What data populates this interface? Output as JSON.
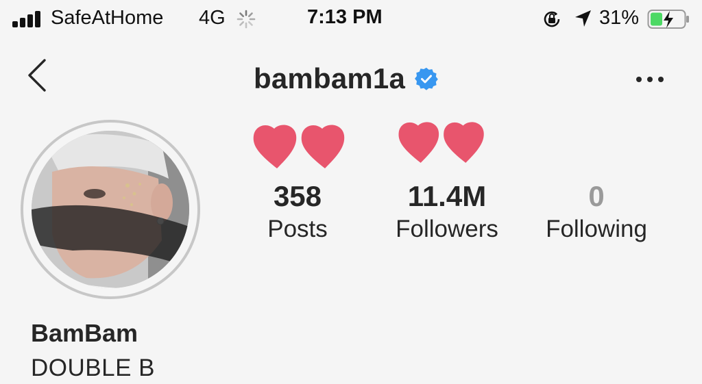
{
  "status_bar": {
    "carrier": "SafeAtHome",
    "network": "4G",
    "time": "7:13 PM",
    "battery_percent": "31%",
    "icons": [
      "signal-icon",
      "loading-spinner-icon",
      "orientation-lock-icon",
      "location-arrow-icon",
      "battery-charging-icon"
    ]
  },
  "header": {
    "username": "bambam1a",
    "verified": true,
    "back_icon": "chevron-left-icon",
    "more_icon": "ellipsis-icon"
  },
  "stats": [
    {
      "value": "358",
      "label": "Posts"
    },
    {
      "value": "11.4M",
      "label": "Followers"
    },
    {
      "value": "0",
      "label": "Following"
    }
  ],
  "bio": {
    "name": "BamBam",
    "text": "DOUBLE B"
  },
  "colors": {
    "background": "#f5f5f5",
    "text": "#262626",
    "verified_blue": "#3897f0",
    "heart_pink": "#e8556d",
    "muted": "#9a9a9a"
  }
}
